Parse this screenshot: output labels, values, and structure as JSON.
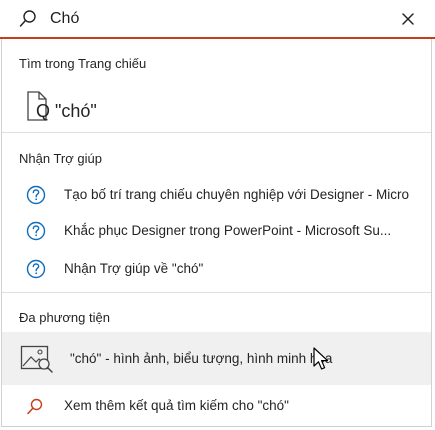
{
  "search": {
    "value": "Chó",
    "placeholder": ""
  },
  "sections": {
    "find_in_slides": {
      "title": "Tìm trong Trang chiếu",
      "item_label": "Q \"chó\""
    },
    "get_help": {
      "title": "Nhận Trợ giúp",
      "items": [
        {
          "label": "Tạo bố trí trang chiếu chuyên nghiệp với Designer - Micro"
        },
        {
          "label": "Khắc phục Designer trong PowerPoint - Microsoft Su..."
        },
        {
          "label": "Nhận Trợ giúp về \"chó\""
        }
      ]
    },
    "media": {
      "title": "Đa phương tiện",
      "item_label": "\"chó\" - hình ảnh, biểu tượng, hình minh họa"
    }
  },
  "more_results": {
    "label": "Xem thêm kết quả tìm kiếm cho \"chó\""
  },
  "colors": {
    "accent": "#c43e1c",
    "help_icon": "#0f6cbd",
    "highlight_bg": "#f0f0f0"
  },
  "icons": {
    "search": "search-icon",
    "clear": "close-icon",
    "find_doc": "document-search-icon",
    "help": "help-circle-icon",
    "media": "image-search-icon",
    "more": "search-icon"
  }
}
